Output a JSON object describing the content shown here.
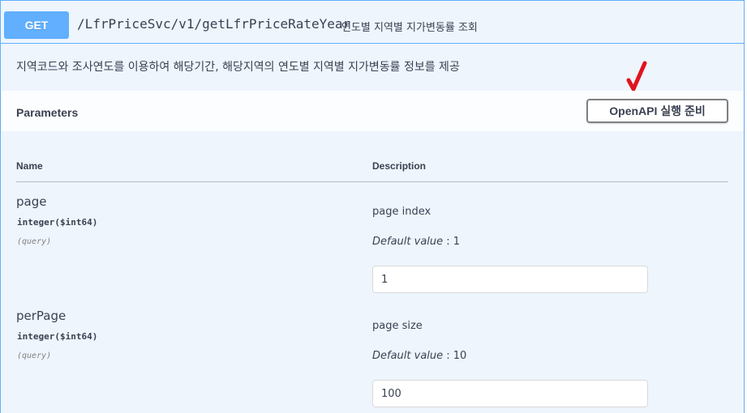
{
  "operation": {
    "method": "GET",
    "path": "/LfrPriceSvc/v1/getLfrPriceRateYear",
    "summary": "연도별 지역별 지가변동률 조회",
    "description": "지역코드와 조사연도를 이용하여 해당기간, 해당지역의 연도별 지역별 지가변동률 정보를 제공"
  },
  "parameters_section": {
    "title": "Parameters",
    "try_button_label": "OpenAPI 실행 준비",
    "columns": {
      "name": "Name",
      "description": "Description"
    }
  },
  "parameters": [
    {
      "name": "page",
      "type": "integer($int64)",
      "in": "(query)",
      "description": "page index",
      "default_label": "Default value",
      "default_value": " : 1",
      "input_value": "1"
    },
    {
      "name": "perPage",
      "type": "integer($int64)",
      "in": "(query)",
      "description": "page size",
      "default_label": "Default value",
      "default_value": " : 10",
      "input_value": "100"
    }
  ],
  "colors": {
    "get_accent": "#61affe",
    "block_background": "#eef5fd",
    "annotation_mark": "#e0141e"
  }
}
